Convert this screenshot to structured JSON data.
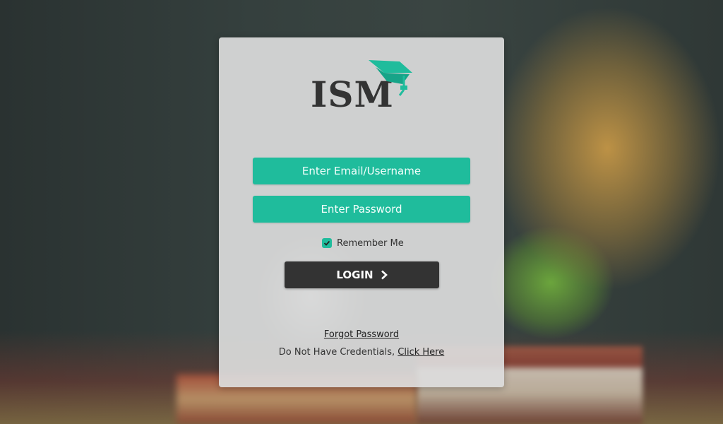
{
  "logo": {
    "text": "ISM"
  },
  "form": {
    "email_placeholder": "Enter Email/Username",
    "password_placeholder": "Enter Password",
    "remember_label": "Remember Me",
    "remember_checked": true,
    "login_label": "LOGIN",
    "forgot_label": "Forgot Password",
    "credentials_text": "Do Not Have Credentials,",
    "click_here_label": "Click Here"
  },
  "colors": {
    "accent": "#1fbc9c",
    "dark": "#333333",
    "card": "#dcdcdc"
  },
  "icons": {
    "login_arrow": "chevron-right-icon",
    "logo_cap": "graduation-cap-icon",
    "checkbox": "check-icon"
  }
}
